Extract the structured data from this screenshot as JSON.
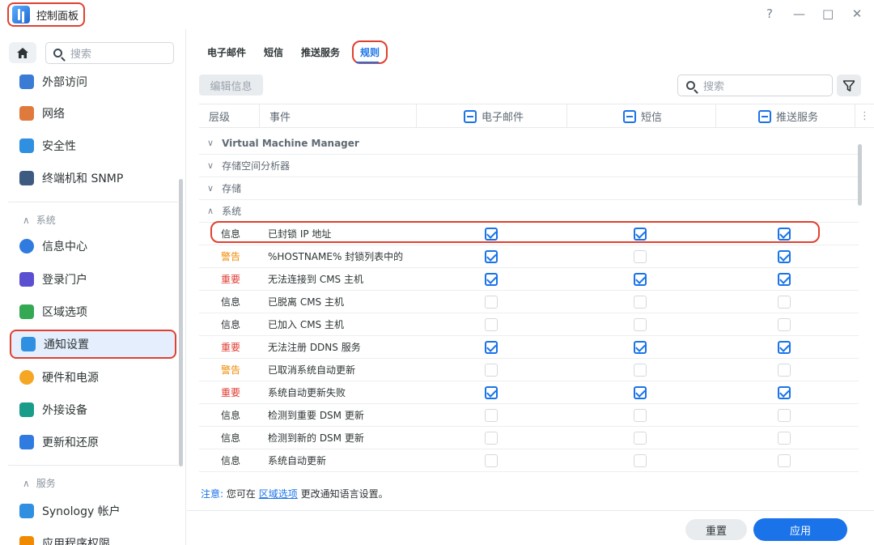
{
  "window": {
    "title": "控制面板",
    "controls": [
      "?",
      "—",
      "□",
      "✕"
    ]
  },
  "sidebar": {
    "search_placeholder": "搜索",
    "items_top": [
      {
        "label": "外部访问",
        "icon": "external-access-icon",
        "color": "#3a7bd5"
      },
      {
        "label": "网络",
        "icon": "network-icon",
        "color": "#e07a3c"
      },
      {
        "label": "安全性",
        "icon": "shield-icon",
        "color": "#2f8fe0"
      },
      {
        "label": "终端机和 SNMP",
        "icon": "terminal-icon",
        "color": "#3d5a80"
      }
    ],
    "section_system": "系统",
    "items_system": [
      {
        "label": "信息中心",
        "icon": "info-icon",
        "color": "#2f7be0"
      },
      {
        "label": "登录门户",
        "icon": "login-portal-icon",
        "color": "#5b4fd1"
      },
      {
        "label": "区域选项",
        "icon": "region-map-icon",
        "color": "#35a853"
      },
      {
        "label": "通知设置",
        "icon": "notification-icon",
        "color": "#2f8fe0",
        "active": true
      },
      {
        "label": "硬件和电源",
        "icon": "bulb-icon",
        "color": "#f5a623"
      },
      {
        "label": "外接设备",
        "icon": "external-device-icon",
        "color": "#1a9c8a"
      },
      {
        "label": "更新和还原",
        "icon": "update-icon",
        "color": "#2f7be0"
      }
    ],
    "section_services": "服务",
    "items_services": [
      {
        "label": "Synology 帐户",
        "icon": "account-icon",
        "color": "#2f8fe0"
      },
      {
        "label": "应用程序权限",
        "icon": "lock-icon",
        "color": "#f08a00"
      }
    ]
  },
  "tabs": [
    {
      "label": "电子邮件"
    },
    {
      "label": "短信"
    },
    {
      "label": "推送服务"
    },
    {
      "label": "规则",
      "active": true
    }
  ],
  "toolbar": {
    "edit_label": "编辑信息",
    "search_placeholder": "搜索"
  },
  "table": {
    "headers": {
      "level": "层级",
      "event": "事件",
      "email": "电子邮件",
      "sms": "短信",
      "push": "推送服务"
    },
    "groups": [
      {
        "label": "Virtual Machine Manager",
        "expanded": false
      },
      {
        "label": "存储空间分析器",
        "expanded": false
      },
      {
        "label": "存储",
        "expanded": false
      },
      {
        "label": "系统",
        "expanded": true
      }
    ],
    "rows": [
      {
        "level": "信息",
        "severity": "info",
        "event": "已封锁 IP 地址",
        "email": true,
        "sms": true,
        "push": true
      },
      {
        "level": "警告",
        "severity": "warn",
        "event": "%HOSTNAME% 封锁列表中的",
        "email": true,
        "sms": false,
        "push": true
      },
      {
        "level": "重要",
        "severity": "crit",
        "event": "无法连接到 CMS 主机",
        "email": true,
        "sms": true,
        "push": true
      },
      {
        "level": "信息",
        "severity": "info",
        "event": "已脱离 CMS 主机",
        "email": false,
        "sms": false,
        "push": false
      },
      {
        "level": "信息",
        "severity": "info",
        "event": "已加入 CMS 主机",
        "email": false,
        "sms": false,
        "push": false
      },
      {
        "level": "重要",
        "severity": "crit",
        "event": "无法注册 DDNS 服务",
        "email": true,
        "sms": true,
        "push": true
      },
      {
        "level": "警告",
        "severity": "warn",
        "event": "已取消系统自动更新",
        "email": false,
        "sms": false,
        "push": false
      },
      {
        "level": "重要",
        "severity": "crit",
        "event": "系统自动更新失败",
        "email": true,
        "sms": true,
        "push": true
      },
      {
        "level": "信息",
        "severity": "info",
        "event": "检测到重要 DSM 更新",
        "email": false,
        "sms": false,
        "push": false
      },
      {
        "level": "信息",
        "severity": "info",
        "event": "检测到新的 DSM 更新",
        "email": false,
        "sms": false,
        "push": false
      },
      {
        "level": "信息",
        "severity": "info",
        "event": "系统自动更新",
        "email": false,
        "sms": false,
        "push": false
      }
    ]
  },
  "note": {
    "label": "注意:",
    "before": "您可在",
    "link": "区域选项",
    "after": "更改通知语言设置。"
  },
  "footer": {
    "reset_label": "重置",
    "apply_label": "应用"
  },
  "colors": {
    "accent": "#1a73e8",
    "highlight": "#e0402f",
    "warn": "#f08a00",
    "crit": "#e03c31"
  }
}
